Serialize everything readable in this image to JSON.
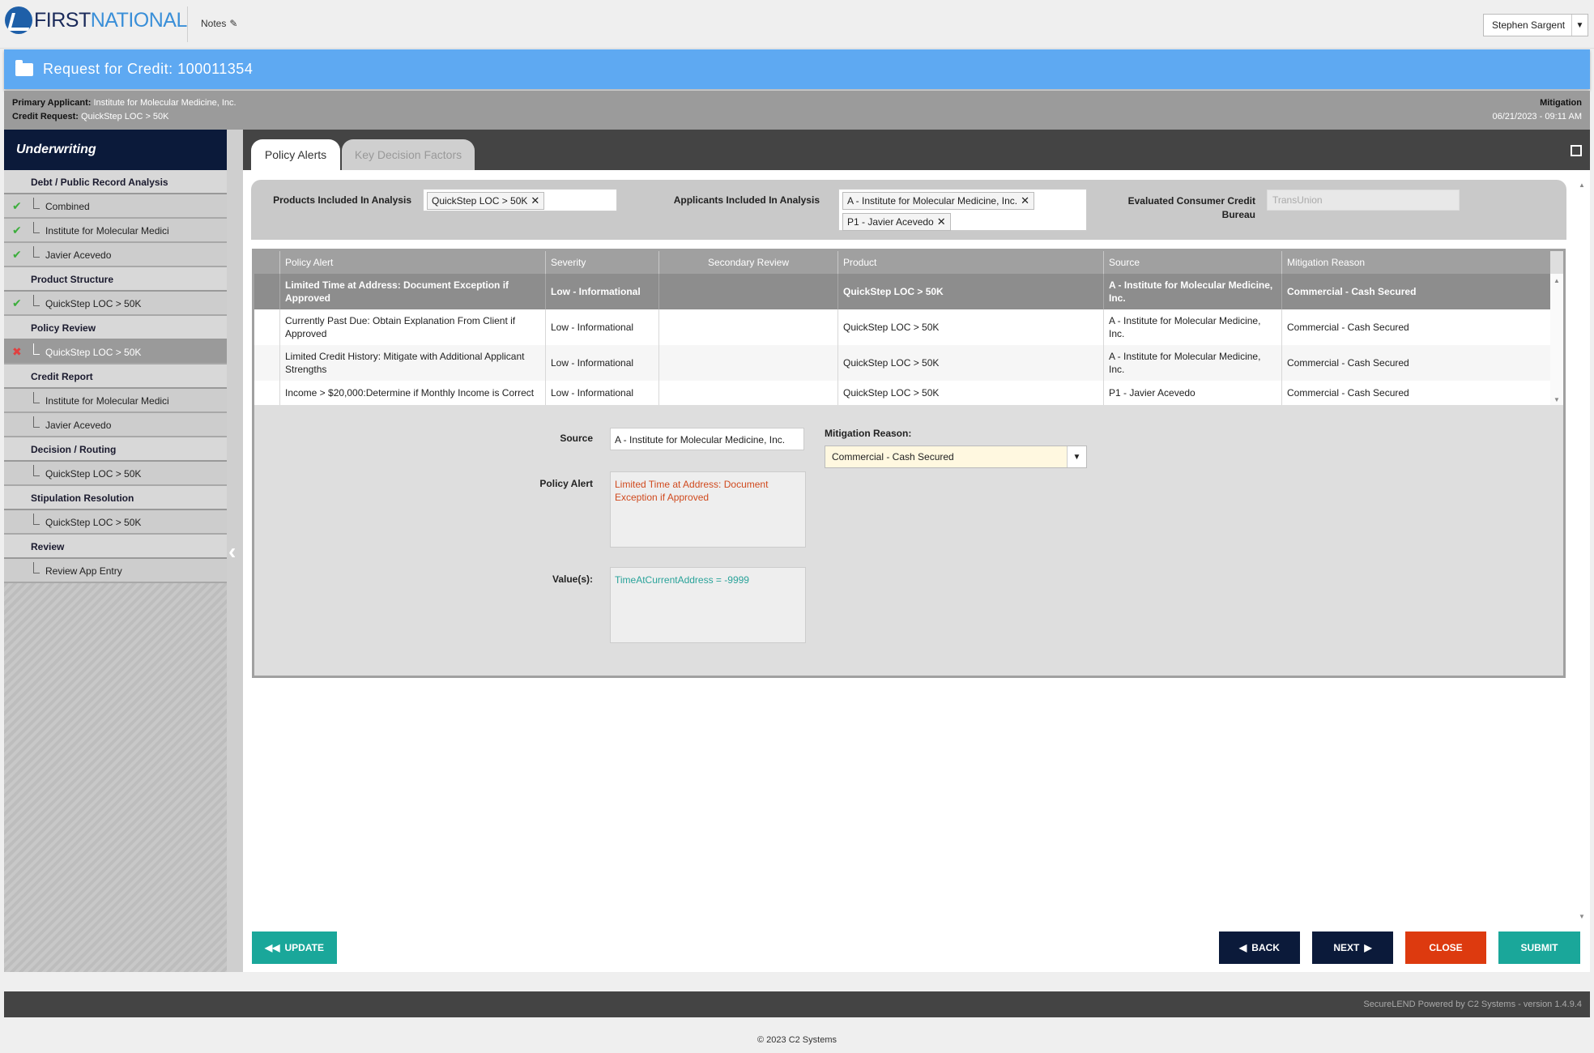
{
  "brand": {
    "first": "FIRST",
    "national": "NATIONAL"
  },
  "header": {
    "notes_label": "Notes",
    "user_name": "Stephen Sargent"
  },
  "title": "Request for Credit: 100011354",
  "info": {
    "primary_applicant_label": "Primary Applicant:",
    "primary_applicant": "Institute for Molecular Medicine, Inc.",
    "credit_request_label": "Credit Request:",
    "credit_request": "QuickStep LOC > 50K",
    "stage": "Mitigation",
    "datetime": "06/21/2023 - 09:11 AM"
  },
  "sidebar": {
    "heading": "Underwriting",
    "sections": [
      {
        "label": "Debt / Public Record Analysis",
        "items": [
          {
            "label": "Combined",
            "status": "check"
          },
          {
            "label": "Institute for Molecular Medici",
            "status": "check"
          },
          {
            "label": "Javier Acevedo",
            "status": "check"
          }
        ]
      },
      {
        "label": "Product Structure",
        "items": [
          {
            "label": "QuickStep LOC > 50K",
            "status": "check"
          }
        ]
      },
      {
        "label": "Policy Review",
        "items": [
          {
            "label": "QuickStep LOC > 50K",
            "status": "cross",
            "active": true
          }
        ]
      },
      {
        "label": "Credit Report",
        "items": [
          {
            "label": "Institute for Molecular Medici",
            "status": ""
          },
          {
            "label": "Javier Acevedo",
            "status": ""
          }
        ]
      },
      {
        "label": "Decision / Routing",
        "items": [
          {
            "label": "QuickStep LOC > 50K",
            "status": ""
          }
        ]
      },
      {
        "label": "Stipulation Resolution",
        "items": [
          {
            "label": "QuickStep LOC > 50K",
            "status": ""
          }
        ]
      },
      {
        "label": "Review",
        "items": [
          {
            "label": "Review App Entry",
            "status": ""
          }
        ]
      }
    ]
  },
  "tabs": {
    "policy_alerts": "Policy Alerts",
    "key_decision_factors": "Key Decision Factors"
  },
  "filters": {
    "products_label": "Products Included In Analysis",
    "products": [
      "QuickStep LOC > 50K"
    ],
    "applicants_label": "Applicants Included In Analysis",
    "applicants": [
      "A - Institute for Molecular Medicine, Inc.",
      "P1 - Javier Acevedo"
    ],
    "bureau_label_1": "Evaluated Consumer Credit",
    "bureau_label_2": "Bureau",
    "bureau_value": "TransUnion"
  },
  "grid": {
    "columns": [
      "Policy Alert",
      "Severity",
      "Secondary Review",
      "Product",
      "Source",
      "Mitigation Reason"
    ],
    "rows": [
      [
        "Limited Time at Address: Document Exception if Approved",
        "Low - Informational",
        "",
        "QuickStep LOC > 50K",
        "A - Institute for Molecular Medicine, Inc.",
        "Commercial - Cash Secured"
      ],
      [
        "Currently Past Due: Obtain Explanation From Client if Approved",
        "Low - Informational",
        "",
        "QuickStep LOC > 50K",
        "A - Institute for Molecular Medicine, Inc.",
        "Commercial - Cash Secured"
      ],
      [
        "Limited Credit History: Mitigate with Additional Applicant Strengths",
        "Low - Informational",
        "",
        "QuickStep LOC > 50K",
        "A - Institute for Molecular Medicine, Inc.",
        "Commercial - Cash Secured"
      ],
      [
        "Income > $20,000:Determine if Monthly Income is Correct",
        "Low - Informational",
        "",
        "QuickStep LOC > 50K",
        "P1 - Javier Acevedo",
        "Commercial - Cash Secured"
      ]
    ]
  },
  "detail": {
    "source_label": "Source",
    "source_value": "A - Institute for Molecular Medicine, Inc.",
    "policy_alert_label": "Policy Alert",
    "policy_alert_value": "Limited Time at Address: Document Exception if Approved",
    "values_label": "Value(s):",
    "values_value": "TimeAtCurrentAddress = -9999",
    "mitigation_label": "Mitigation Reason:",
    "mitigation_value": "Commercial - Cash Secured"
  },
  "buttons": {
    "update": "UPDATE",
    "back": "BACK",
    "next": "NEXT",
    "close": "CLOSE",
    "submit": "SUBMIT"
  },
  "footer": {
    "powered": "SecureLEND Powered by C2 Systems - version 1.4.9.4",
    "copyright": "© 2023 C2 Systems"
  },
  "colors": {
    "title_bar": "#5ea9f2",
    "navy": "#0b1a3a",
    "teal": "#1aa79a",
    "close_red": "#dd3a0f",
    "alert_text": "#d04a1e",
    "values_text": "#2aa39a"
  }
}
